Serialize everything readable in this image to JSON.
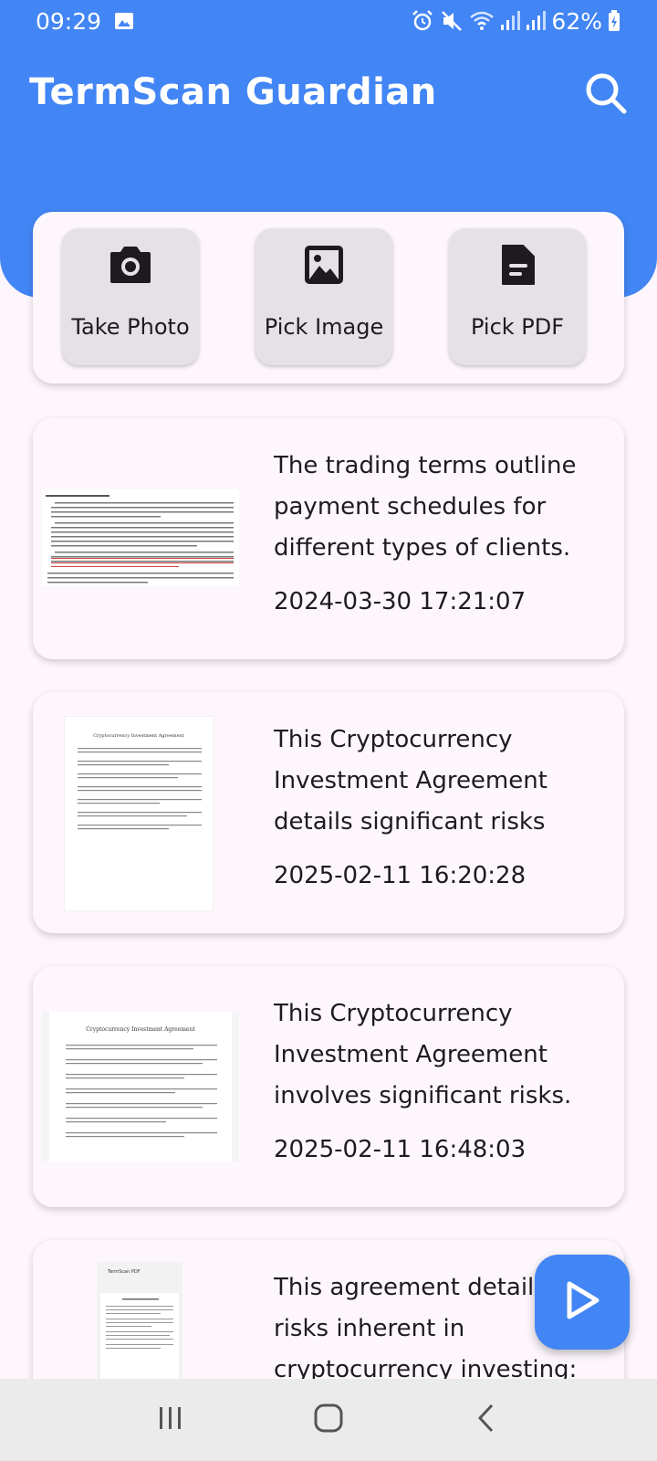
{
  "status_bar": {
    "time": "09:29",
    "battery": "62%",
    "icons": [
      "image-icon",
      "alarm-icon",
      "mute-icon",
      "wifi-icon",
      "signal-icon",
      "signal-icon",
      "battery-charging-icon"
    ]
  },
  "header": {
    "title": "TermScan Guardian",
    "search_icon": "search-icon",
    "color": "#4285f4"
  },
  "actions": [
    {
      "label": "Take Photo",
      "icon": "camera-icon"
    },
    {
      "label": "Pick Image",
      "icon": "image-icon"
    },
    {
      "label": "Pick PDF",
      "icon": "document-icon"
    }
  ],
  "documents": [
    {
      "summary": "The trading terms outline payment schedules for different types of clients.",
      "date": "2024-03-30 17:21:07"
    },
    {
      "summary": "This Cryptocurrency Investment Agreement details significant risks",
      "date": "2025-02-11 16:20:28",
      "thumb_title": "Cryptocurrency Investment Agreement"
    },
    {
      "summary": "This Cryptocurrency Investment Agreement involves significant risks.",
      "date": "2025-02-11 16:48:03",
      "thumb_title": "Cryptocurrency Investment Agreement"
    },
    {
      "summary": "This agreement details high risks inherent in cryptocurrency investing:",
      "thumb_title": "TermScan PDF"
    }
  ],
  "fab": {
    "icon": "play-icon"
  },
  "nav_bar": {
    "icons": [
      "recent-apps-icon",
      "home-icon",
      "back-icon"
    ]
  }
}
